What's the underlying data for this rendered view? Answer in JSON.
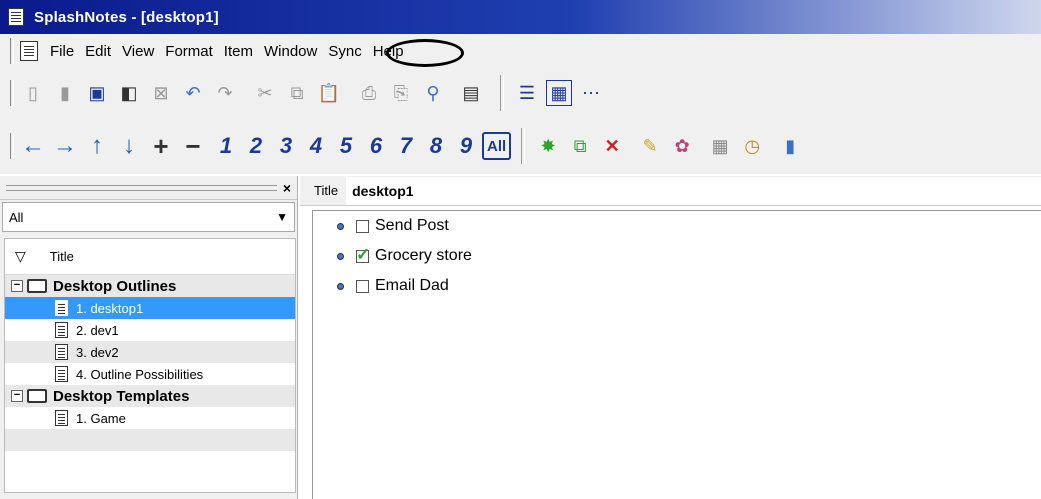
{
  "window": {
    "title": "SplashNotes - [desktop1]"
  },
  "menu": {
    "items": [
      "File",
      "Edit",
      "View",
      "Format",
      "Item",
      "Window",
      "Sync",
      "Help"
    ]
  },
  "toolbar2": {
    "levels": [
      "1",
      "2",
      "3",
      "4",
      "5",
      "6",
      "7",
      "8",
      "9"
    ],
    "all_label": "All"
  },
  "left_panel": {
    "filter_value": "All",
    "tree_header": "Title",
    "groups": [
      {
        "label": "Desktop Outlines",
        "items": [
          "1. desktop1",
          "2. dev1",
          "3. dev2",
          "4. Outline Possibilities"
        ]
      },
      {
        "label": "Desktop Templates",
        "items": [
          "1. Game"
        ]
      }
    ],
    "selected_item": "1. desktop1"
  },
  "editor": {
    "title_label": "Title",
    "title_value": "desktop1",
    "items": [
      {
        "text": "Send Post",
        "checked": false
      },
      {
        "text": "Grocery store",
        "checked": true
      },
      {
        "text": "Email Dad",
        "checked": false
      }
    ]
  },
  "colors": {
    "selection": "#3399ff",
    "titlebar": "#0a1a8c",
    "level_buttons": "#1a3a9a",
    "check": "#2aa52a"
  }
}
